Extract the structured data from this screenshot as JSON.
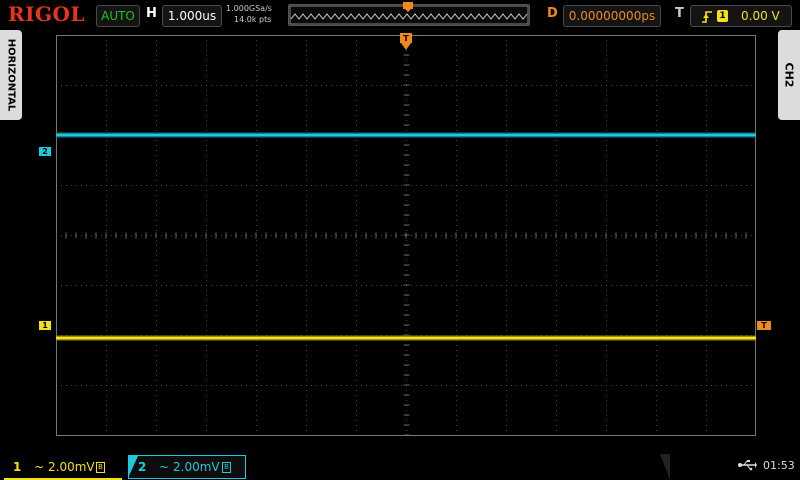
{
  "header": {
    "brand": "RIGOL",
    "run_status": "AUTO",
    "horizontal_label": "H",
    "timebase": "1.000us",
    "sample_rate": "1.000GSa/s",
    "memory_depth": "14.0k pts",
    "delay_label": "D",
    "delay_value": "0.00000000ps",
    "trigger_label": "T",
    "trigger_edge": "rising-edge-icon",
    "trigger_source": "1",
    "trigger_level": "0.00 V"
  },
  "side_tabs": {
    "left": "HORIZONTAL",
    "right": "CH2"
  },
  "markers": {
    "ch1": "1",
    "ch2": "2",
    "trigger": "T"
  },
  "channels": [
    {
      "number": "1",
      "coupling": "~",
      "scale": "2.00mV",
      "color": "#f4e11a",
      "bw_icon": "B"
    },
    {
      "number": "2",
      "coupling": "~",
      "scale": "2.00mV",
      "color": "#1ec8de",
      "bw_icon": "B"
    }
  ],
  "status_bar": {
    "usb_icon": "usb-icon",
    "time": "01:53"
  },
  "colors": {
    "ch1": "#f4e11a",
    "ch2": "#1ec8de",
    "trigger": "#f08a1a",
    "brand": "#e8341c",
    "run_status": "#19c41a"
  }
}
